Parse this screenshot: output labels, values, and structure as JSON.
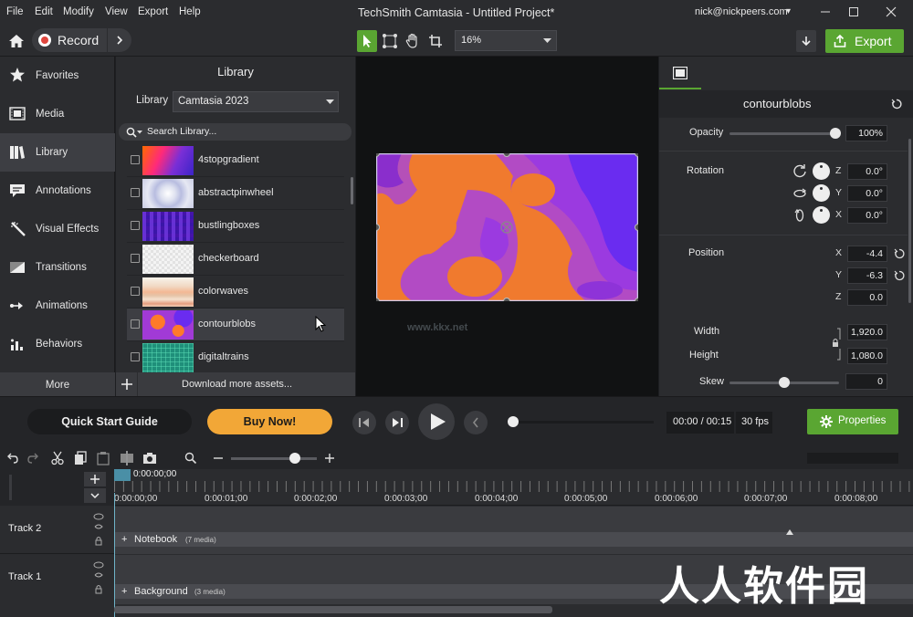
{
  "menu": {
    "items": [
      "File",
      "Edit",
      "Modify",
      "View",
      "Export",
      "Help"
    ],
    "window_title": "TechSmith Camtasia - Untitled Project*",
    "account": "nick@nickpeers.com",
    "account_caret": "▾"
  },
  "toolbar": {
    "record_label": "Record",
    "zoom_value": "16%",
    "export_label": "Export"
  },
  "leftnav": {
    "items": [
      {
        "label": "Favorites",
        "icon": "star-icon"
      },
      {
        "label": "Media",
        "icon": "film-icon"
      },
      {
        "label": "Library",
        "icon": "books-icon"
      },
      {
        "label": "Annotations",
        "icon": "annotation-icon"
      },
      {
        "label": "Visual Effects",
        "icon": "wand-icon"
      },
      {
        "label": "Transitions",
        "icon": "transition-icon"
      },
      {
        "label": "Animations",
        "icon": "animation-icon"
      },
      {
        "label": "Behaviors",
        "icon": "behavior-icon"
      }
    ],
    "more_label": "More"
  },
  "library": {
    "title": "Library",
    "picker_label": "Library",
    "picker_value": "Camtasia 2023",
    "search_placeholder": "Search Library...",
    "items": [
      {
        "name": "4stopgradient"
      },
      {
        "name": "abstractpinwheel"
      },
      {
        "name": "bustlingboxes"
      },
      {
        "name": "checkerboard"
      },
      {
        "name": "colorwaves"
      },
      {
        "name": "contourblobs"
      },
      {
        "name": "digitaltrains"
      }
    ],
    "download_label": "Download more assets..."
  },
  "canvas": {
    "watermark": "www.kkx.net"
  },
  "properties": {
    "title": "contourblobs",
    "opacity_label": "Opacity",
    "opacity_value": "100%",
    "opacity_level": 1.0,
    "rotation_label": "Rotation",
    "rotation": [
      {
        "axis": "Z",
        "value": "0.0°"
      },
      {
        "axis": "Y",
        "value": "0.0°"
      },
      {
        "axis": "X",
        "value": "0.0°"
      }
    ],
    "position_label": "Position",
    "position": [
      {
        "axis": "X",
        "value": "-4.4"
      },
      {
        "axis": "Y",
        "value": "-6.3"
      },
      {
        "axis": "Z",
        "value": "0.0"
      }
    ],
    "width_label": "Width",
    "width_value": "1,920.0",
    "height_label": "Height",
    "height_value": "1,080.0",
    "skew_label": "Skew",
    "skew_value": "0",
    "skew_level": 0.5
  },
  "playback": {
    "quick_start_label": "Quick Start Guide",
    "buy_now_label": "Buy Now!",
    "time_display": "00:00 / 00:15",
    "fps_label": "30 fps",
    "properties_label": "Properties"
  },
  "timeline": {
    "playhead_time": "0:00:00;00",
    "ruler_labels": [
      "0:00:00;00",
      "0:00:01;00",
      "0:00:02;00",
      "0:00:03;00",
      "0:00:04;00",
      "0:00:05;00",
      "0:00:06;00",
      "0:00:07;00",
      "0:00:08;00"
    ],
    "tracks": [
      {
        "name": "Track 2",
        "group": "Notebook",
        "media_count": "(7 media)"
      },
      {
        "name": "Track 1",
        "group": "Background",
        "media_count": "(3 media)"
      }
    ]
  },
  "overlay_watermark": "人人软件园",
  "colors": {
    "accent_green": "#5aa632",
    "record_red": "#e0463e",
    "buy_now_orange": "#f2a737",
    "selection": "#3d3e43"
  }
}
